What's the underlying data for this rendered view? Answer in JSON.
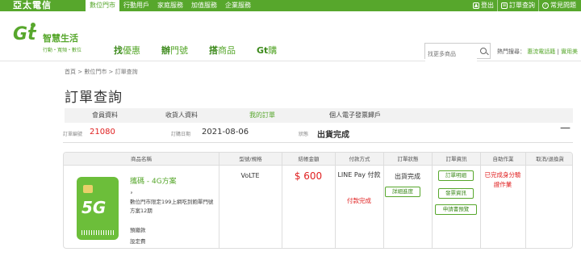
{
  "topbar": {
    "brand": "亞太電信",
    "tabs": [
      "數位門市",
      "行動用戶",
      "家庭服務",
      "加值服務",
      "企業服務"
    ],
    "right": [
      "登出",
      "訂單查詢",
      "常見問題"
    ]
  },
  "header": {
    "logo_text": "Gt",
    "logo_name": "智慧生活",
    "logo_tagline": "行動・寬頻・數位",
    "nav": [
      {
        "lead": "找",
        "rest": "優惠"
      },
      {
        "lead": "辦",
        "rest": "門號"
      },
      {
        "lead": "搭",
        "rest": "商品"
      },
      {
        "lead": "Gt",
        "rest": "購"
      }
    ],
    "search_placeholder": "找更多商品",
    "hot_label": "熱門搜尋：",
    "hot_items": [
      "惠流電話籍",
      "實用美"
    ]
  },
  "breadcrumb": "首頁  >  數位門市  >  訂單查詢",
  "page_title": "訂單查詢",
  "tabs": [
    "會員資料",
    "收貨人資料",
    "我的訂單",
    "個人電子發票歸戶"
  ],
  "active_tab": 2,
  "order": {
    "number_label": "訂單編號",
    "number": "21080",
    "date_label": "訂購日期",
    "date": "2021-08-06",
    "status_label": "狀態",
    "status": "出貨完成",
    "collapse_symbol": "—"
  },
  "table": {
    "headers": [
      "商品名稱",
      "型號/規格",
      "結帳金額",
      "付款方式",
      "訂單狀態",
      "訂單資訊",
      "自助作業",
      "取消/退換貨"
    ],
    "row": {
      "product_name": "攜碼 - 4G方案",
      "product_sub": "，",
      "product_desc": "數位門市限定199上網吃到飽單門號方案12期",
      "product_line1": "預繳款",
      "product_line2": "設定費",
      "spec": "VoLTE",
      "price": "$ 600",
      "pay_method": "LINE Pay 付款",
      "pay_status": "付款完成",
      "order_status": "出貨完成",
      "progress_button": "詳細進度",
      "info_buttons": [
        "訂單明細",
        "發票資訊",
        "申請書預覽"
      ],
      "self_service": "已完成身分驗證作業",
      "cancel": ""
    }
  },
  "colors": {
    "brand_green": "#57a72c",
    "price_red": "#e02020"
  }
}
